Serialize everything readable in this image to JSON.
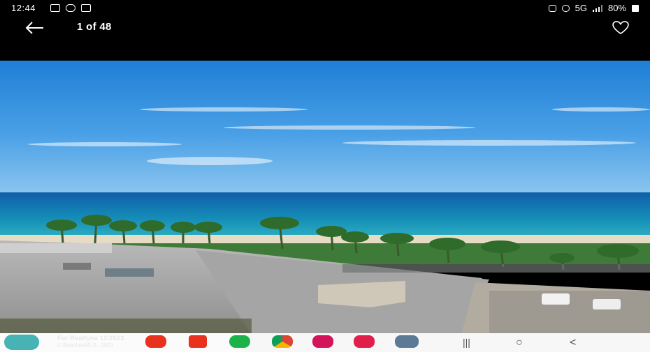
{
  "status_bar": {
    "time": "12:44",
    "network": "5G",
    "battery": "80%",
    "left_icons": [
      "message-icon",
      "missed-call-icon",
      "gallery-icon"
    ],
    "right_icons": [
      "camera-icon",
      "alarm-icon",
      "signal-icon",
      "battery-icon"
    ]
  },
  "app_bar": {
    "counter": "1 of 48",
    "back_icon": "arrow-left-icon",
    "favorite_icon": "heart-outline-icon"
  },
  "photo": {
    "subject": "ocean-view-from-balcony"
  },
  "watermark": {
    "line1": "For Realtyna   12/2023",
    "line2": "© BeachesMLS . 2023"
  },
  "app_tray": {
    "icons": [
      "youtube-icon",
      "home-app-icon",
      "phone-green-icon",
      "chrome-icon",
      "flower-app-icon",
      "camera-app-icon",
      "apps-grid-icon"
    ],
    "colors": [
      "#e8321e",
      "#e8321e",
      "#1bb24a",
      "#4285f4",
      "#d4145a",
      "#e0204a",
      "#5b7a95"
    ]
  },
  "nav_bar": {
    "recent": "|||",
    "home": "○",
    "back": "<"
  }
}
